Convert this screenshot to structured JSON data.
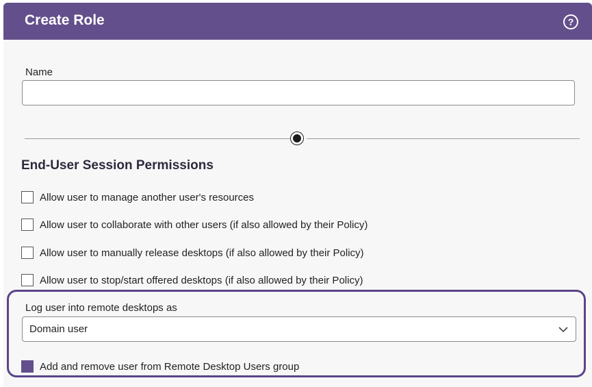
{
  "dialog": {
    "title": "Create Role",
    "help_icon": "help-circle-icon",
    "help_glyph": "?"
  },
  "name_field": {
    "label": "Name",
    "value": "",
    "placeholder": ""
  },
  "section": {
    "title": "End-User Session Permissions"
  },
  "permissions": [
    {
      "label": "Allow user to manage another user's resources",
      "checked": false
    },
    {
      "label": "Allow user to collaborate with other users (if also allowed by their Policy)",
      "checked": false
    },
    {
      "label": "Allow user to manually release desktops (if also allowed by their Policy)",
      "checked": false
    },
    {
      "label": "Allow user to stop/start offered desktops (if also allowed by their Policy)",
      "checked": false
    }
  ],
  "login": {
    "label": "Log user into remote desktops as",
    "selected": "Domain user",
    "dropdown_icon": "chevron-down-icon"
  },
  "rdu_group": {
    "label": "Add and remove user from Remote Desktop Users group",
    "checked": true
  },
  "colors": {
    "header": "#634f8b",
    "highlight_border": "#5a4489",
    "checked_box": "#634f8b"
  }
}
